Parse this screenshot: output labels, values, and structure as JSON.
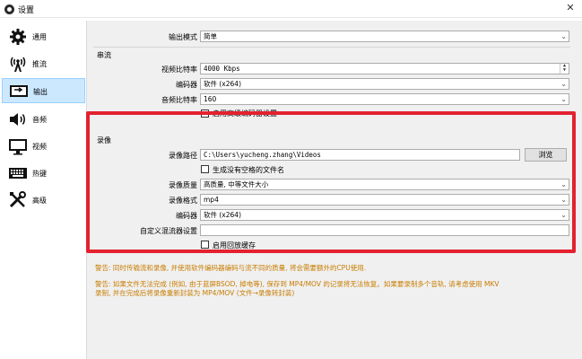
{
  "window": {
    "title": "设置",
    "close_glyph": "✕"
  },
  "sidebar": {
    "items": [
      {
        "label": "通用",
        "icon": "gear-icon"
      },
      {
        "label": "推流",
        "icon": "broadcast-icon"
      },
      {
        "label": "输出",
        "icon": "output-icon"
      },
      {
        "label": "音频",
        "icon": "speaker-icon"
      },
      {
        "label": "视频",
        "icon": "monitor-icon"
      },
      {
        "label": "热键",
        "icon": "keyboard-icon"
      },
      {
        "label": "高级",
        "icon": "tools-icon"
      }
    ],
    "selected": "输出"
  },
  "output_mode": {
    "label": "输出模式",
    "value": "简单"
  },
  "streaming": {
    "title": "串流",
    "video_bitrate_label": "视频比特率",
    "video_bitrate_value": "4000 Kbps",
    "encoder_label": "编码器",
    "encoder_value": "软件 (x264)",
    "audio_bitrate_label": "音频比特率",
    "audio_bitrate_value": "160",
    "advanced_checkbox_label": "启用高级编码器设置"
  },
  "recording": {
    "title": "录像",
    "path_label": "录像路径",
    "path_value": "C:\\Users\\yucheng.zhang\\Videos",
    "browse_label": "浏览",
    "no_space_label": "生成没有空格的文件名",
    "quality_label": "录像质量",
    "quality_value": "高质量, 中等文件大小",
    "format_label": "录像格式",
    "format_value": "mp4",
    "encoder_label": "编码器",
    "encoder_value": "软件 (x264)",
    "muxer_label": "自定义混流器设置",
    "muxer_value": "",
    "replay_buffer_label": "启用回放缓存"
  },
  "warnings": {
    "line1": "警告: 同时传输流和录像, 并使用软件编码器编码与流不同的质量, 将会需要额外的CPU使用.",
    "line2": "警告: 如果文件无法完成 (例如, 由于蓝屏BSOD, 掉电等), 保存到 MP4/MOV 的记录将无法恢复。如果要录制多个音轨, 请考虑使用 MKV",
    "line3": "录制, 并在完成后将录像重新封装为 MP4/MOV (文件→录像转封装)"
  },
  "colors": {
    "highlight_frame": "#e3212f",
    "warning_text": "#c87d00",
    "selected_nav": "#cce8ff"
  }
}
